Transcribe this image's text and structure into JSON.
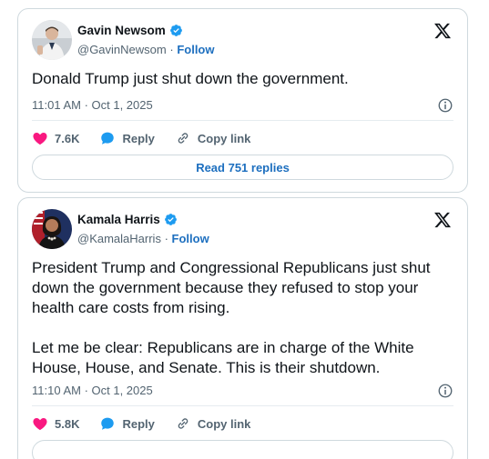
{
  "colors": {
    "link": "#1d6fbf",
    "heart": "#f91880",
    "reply": "#1d9bf0",
    "verified": "#1d9bf0",
    "muted": "#536471"
  },
  "tweets": [
    {
      "name": "Gavin Newsom",
      "handle": "@GavinNewsom",
      "separator": "·",
      "follow": "Follow",
      "text": "Donald Trump just shut down the government.",
      "timestamp": "11:01 AM · Oct 1, 2025",
      "likes": "7.6K",
      "reply_label": "Reply",
      "copy_label": "Copy link",
      "read_replies": "Read 751 replies"
    },
    {
      "name": "Kamala Harris",
      "handle": "@KamalaHarris",
      "separator": "·",
      "follow": "Follow",
      "text": "President Trump and Congressional Republicans just shut down the government because they refused to stop your health care costs from rising.\n\nLet me be clear: Republicans are in charge of the White House, House, and Senate. This is their shutdown.",
      "timestamp": "11:10 AM · Oct 1, 2025",
      "likes": "5.8K",
      "reply_label": "Reply",
      "copy_label": "Copy link"
    }
  ]
}
